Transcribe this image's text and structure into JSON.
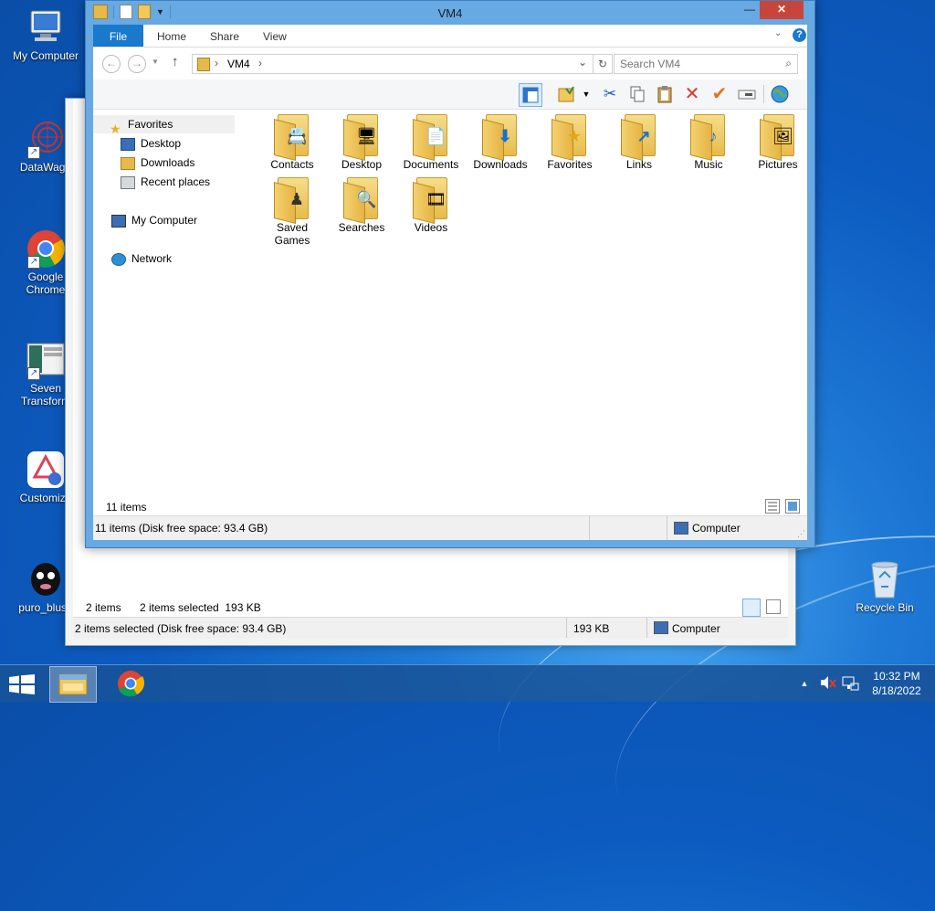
{
  "desktop": {
    "icons": [
      {
        "label": "My Computer",
        "icon": "computer-icon"
      },
      {
        "label": "DataWago",
        "icon": "datawago-icon"
      },
      {
        "label": "Google Chrome",
        "icon": "chrome-icon"
      },
      {
        "label": "Seven Transform",
        "icon": "seven-transform-icon"
      },
      {
        "label": "Customize",
        "icon": "customize-icon"
      },
      {
        "label": "puro_blush",
        "icon": "puro-blush-icon"
      },
      {
        "label": "Recycle Bin",
        "icon": "recycle-bin-icon"
      }
    ]
  },
  "back_window": {
    "status_items": "2 items",
    "status_selected": "2 items selected  193 KB",
    "status_bar_left": "2 items selected (Disk free space: 93.4 GB)",
    "status_bar_size": "193 KB",
    "status_bar_location": "Computer"
  },
  "window": {
    "title": "VM4",
    "minimize": "—",
    "maximize": "□",
    "close": "✕",
    "tabs": {
      "file": "File",
      "home": "Home",
      "share": "Share",
      "view": "View"
    },
    "address": {
      "path": "VM4",
      "separator": "›"
    },
    "search": {
      "placeholder": "Search VM4"
    },
    "nav_pane": {
      "favorites": "Favorites",
      "desktop": "Desktop",
      "downloads": "Downloads",
      "recent": "Recent places",
      "computer": "My Computer",
      "network": "Network"
    },
    "items": [
      {
        "label": "Contacts",
        "emblem": "📇"
      },
      {
        "label": "Desktop",
        "emblem": "🖥"
      },
      {
        "label": "Documents",
        "emblem": "📄"
      },
      {
        "label": "Downloads",
        "emblem": "⬇"
      },
      {
        "label": "Favorites",
        "emblem": "★"
      },
      {
        "label": "Links",
        "emblem": "↗"
      },
      {
        "label": "Music",
        "emblem": "♪"
      },
      {
        "label": "Pictures",
        "emblem": "🖼"
      },
      {
        "label": "Saved Games",
        "emblem": "♟"
      },
      {
        "label": "Searches",
        "emblem": "🔍"
      },
      {
        "label": "Videos",
        "emblem": "🎞"
      }
    ],
    "item_count": "11 items",
    "status_bar_left": "11 items (Disk free space: 93.4 GB)",
    "status_bar_location": "Computer"
  },
  "taskbar": {
    "time": "10:32 PM",
    "date": "8/18/2022"
  },
  "colors": {
    "accent": "#1979ca",
    "title_frame": "#66a9e3",
    "desktop": "#0c5bc0"
  }
}
